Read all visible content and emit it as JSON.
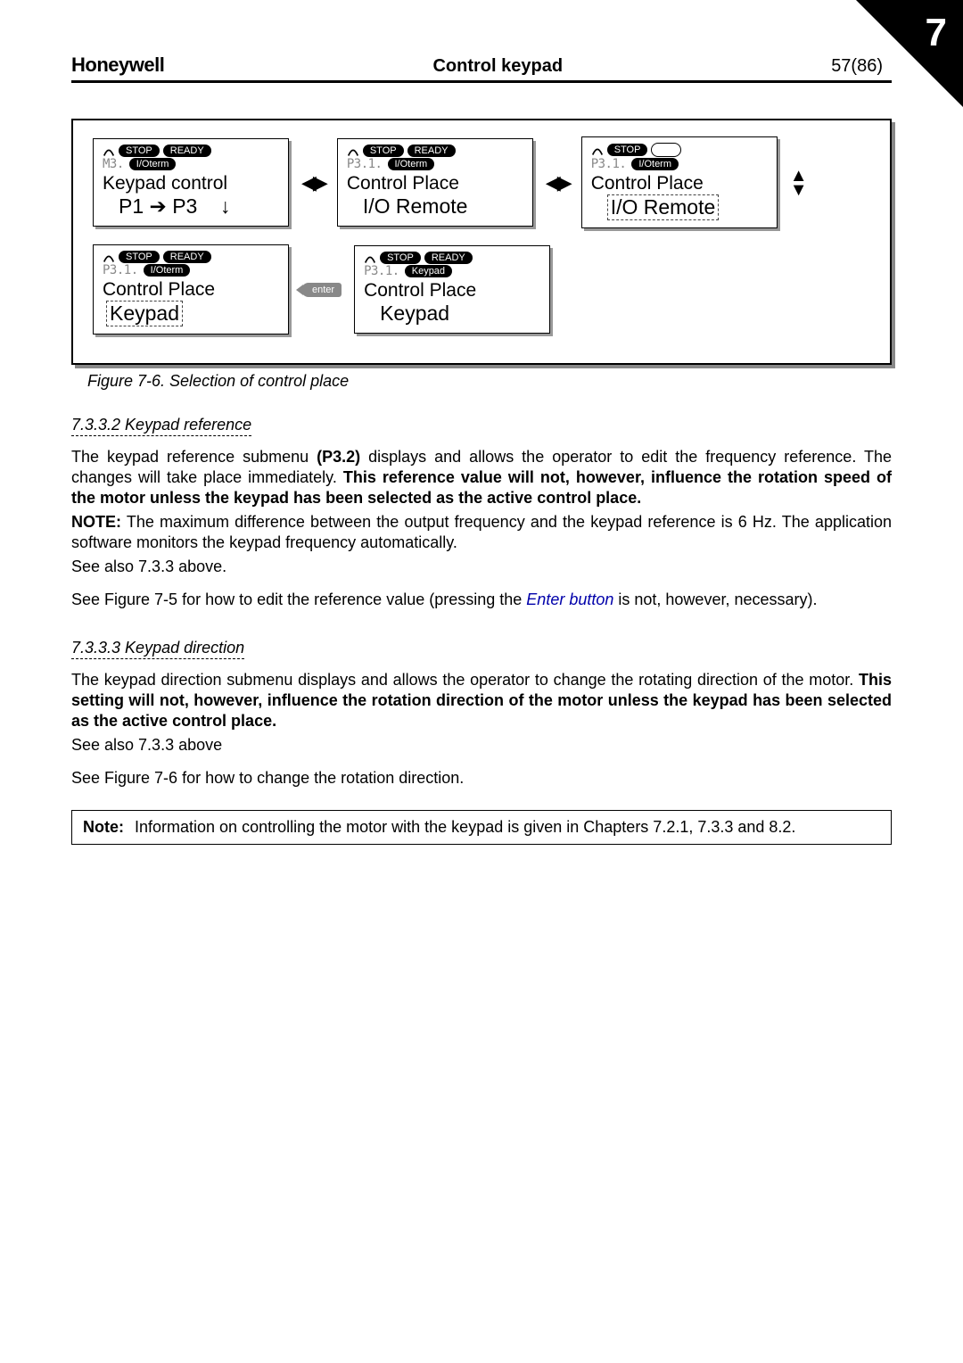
{
  "chapter_tab": "7",
  "header": {
    "brand": "Honeywell",
    "title": "Control keypad",
    "page": "57(86)"
  },
  "diagram": {
    "cap_stop": "STOP",
    "cap_ready": "READY",
    "cap_ioterm": "I/Oterm",
    "cap_keypad": "Keypad",
    "panel1": {
      "id": "M3.",
      "line1": "Keypad control",
      "line2_pre": "P1",
      "line2_post": "P3"
    },
    "panel2": {
      "id": "P3.1.",
      "line1": "Control Place",
      "line2": "I/O Remote"
    },
    "panel3": {
      "id": "P3.1.",
      "line1": "Control Place",
      "line2": "I/O Remote"
    },
    "panel4": {
      "id": "P3.1.",
      "line1": "Control Place",
      "line2": "Keypad"
    },
    "panel5": {
      "id": "P3.1.",
      "line1": "Control Place",
      "line2": "Keypad"
    },
    "enter_label": "enter"
  },
  "caption": "Figure 7-6. Selection of control place",
  "sec1": {
    "heading": "7.3.3.2    Keypad reference",
    "p1a": "The keypad reference submenu ",
    "p1b": "(P3.2)",
    "p1c": " displays and allows the operator to edit the frequency reference. The changes will take place immediately. ",
    "p1d": "This reference value will not, however, influence the rotation speed of the motor unless the keypad has been selected as the active control place.",
    "note_line": "NOTE:",
    "note_rest": " The maximum difference between the output frequency and the keypad reference is 6 Hz. The application software monitors the keypad frequency automatically.",
    "see1": "See also 7.3.3 above.",
    "see2a": "See Figure 7-5 for how to edit the reference value (pressing the ",
    "see2b": "Enter button",
    "see2c": " is not, however, necessary)."
  },
  "sec2": {
    "heading": "7.3.3.3    Keypad direction",
    "p1a": "The keypad direction submenu displays and allows the operator to change the rotating direction of the motor. ",
    "p1b": "This setting will not, however, influence the rotation direction of the motor unless the keypad has been selected as the active control place.",
    "see1": "See also 7.3.3 above",
    "see2": "See Figure 7-6 for how to change the rotation direction."
  },
  "notebox": {
    "label": "Note:",
    "text": "Information on controlling the motor with the keypad is given in Chapters 7.2.1, 7.3.3 and 8.2."
  }
}
